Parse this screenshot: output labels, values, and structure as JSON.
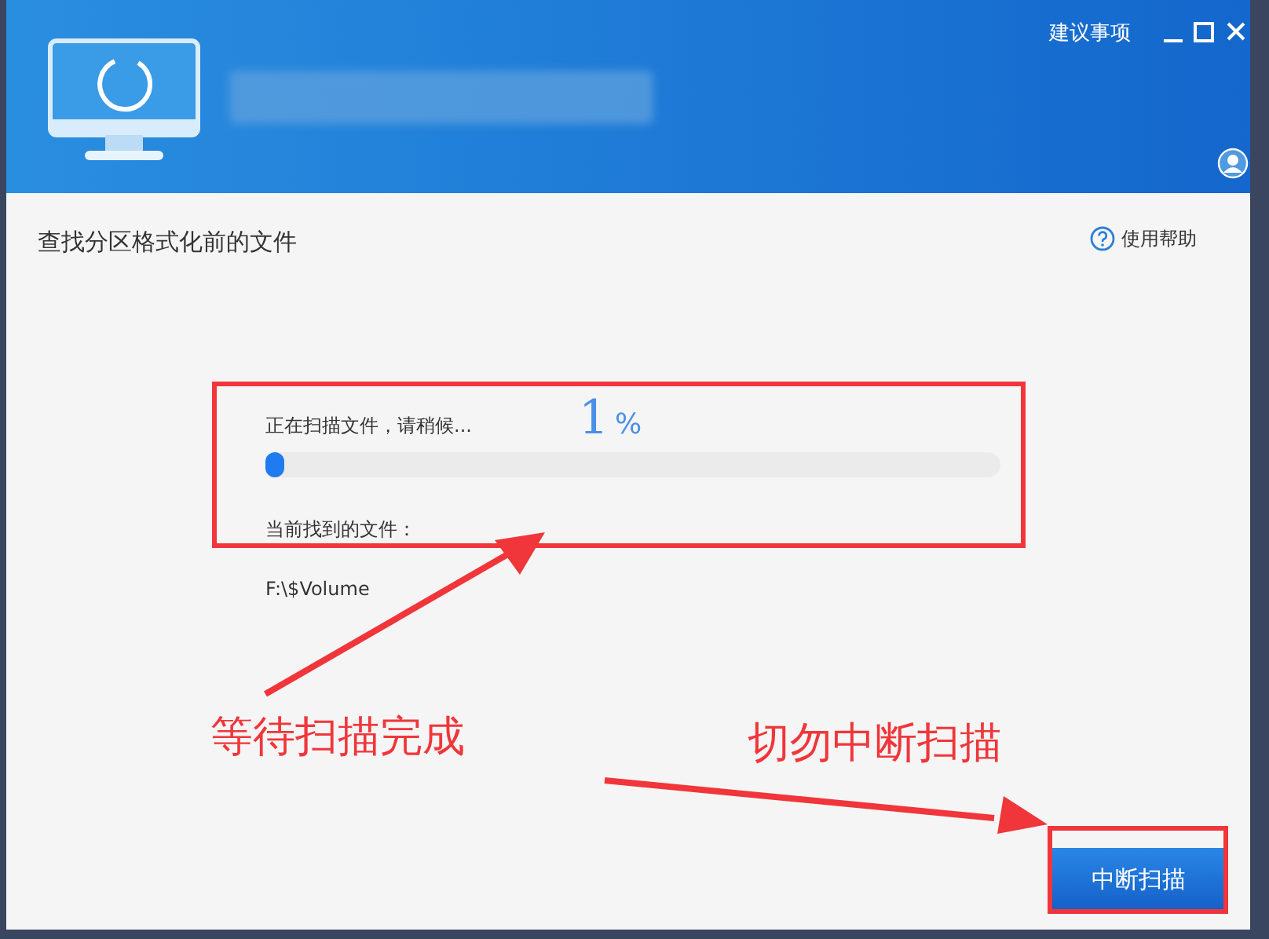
{
  "header": {
    "feedback_link": "建议事项"
  },
  "page": {
    "title": "查找分区格式化前的文件",
    "help_link": "使用帮助"
  },
  "scan": {
    "status": "正在扫描文件，请稍候...",
    "percent": "1",
    "percent_sign": "%",
    "level": 0.01,
    "found_label": "当前找到的文件：",
    "current_file": "F:\\$Volume"
  },
  "stop_button": "中断扫描",
  "annotations": [
    {
      "text": "等待扫描完成"
    },
    {
      "text": "切勿中断扫描"
    }
  ]
}
